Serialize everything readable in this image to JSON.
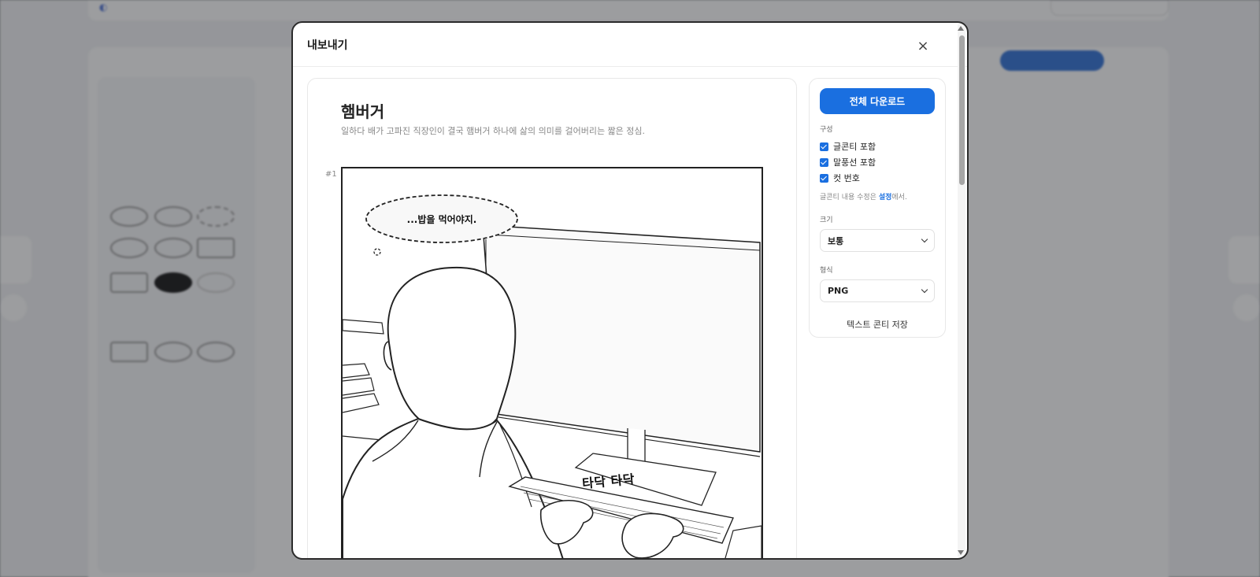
{
  "modal": {
    "title": "내보내기",
    "close_icon": "×"
  },
  "preview": {
    "title": "햄버거",
    "subtitle": "일하다 배가 고파진 직장인이 결국 햄버거 하나에 삶의 의미를 걸어버리는 짧은 정심.",
    "cut_number": "#1",
    "speech_bubble": "...밥을 먹어야지.",
    "sfx": "타닥 타닥"
  },
  "side": {
    "download_label": "전체 다운로드",
    "composition_label": "구성",
    "options": [
      {
        "label": "글콘티 포함",
        "checked": true
      },
      {
        "label": "말풍선 포함",
        "checked": true
      },
      {
        "label": "컷 번호",
        "checked": true
      }
    ],
    "hint_prefix": "글콘티 내용 수정은 ",
    "hint_link": "설정",
    "hint_suffix": "에서.",
    "size_label": "크기",
    "size_value": "보통",
    "format_label": "형식",
    "format_value": "PNG",
    "save_text_label": "텍스트 콘티 저장"
  },
  "colors": {
    "accent": "#1a6fe0",
    "overlay": "#5a5c60"
  }
}
